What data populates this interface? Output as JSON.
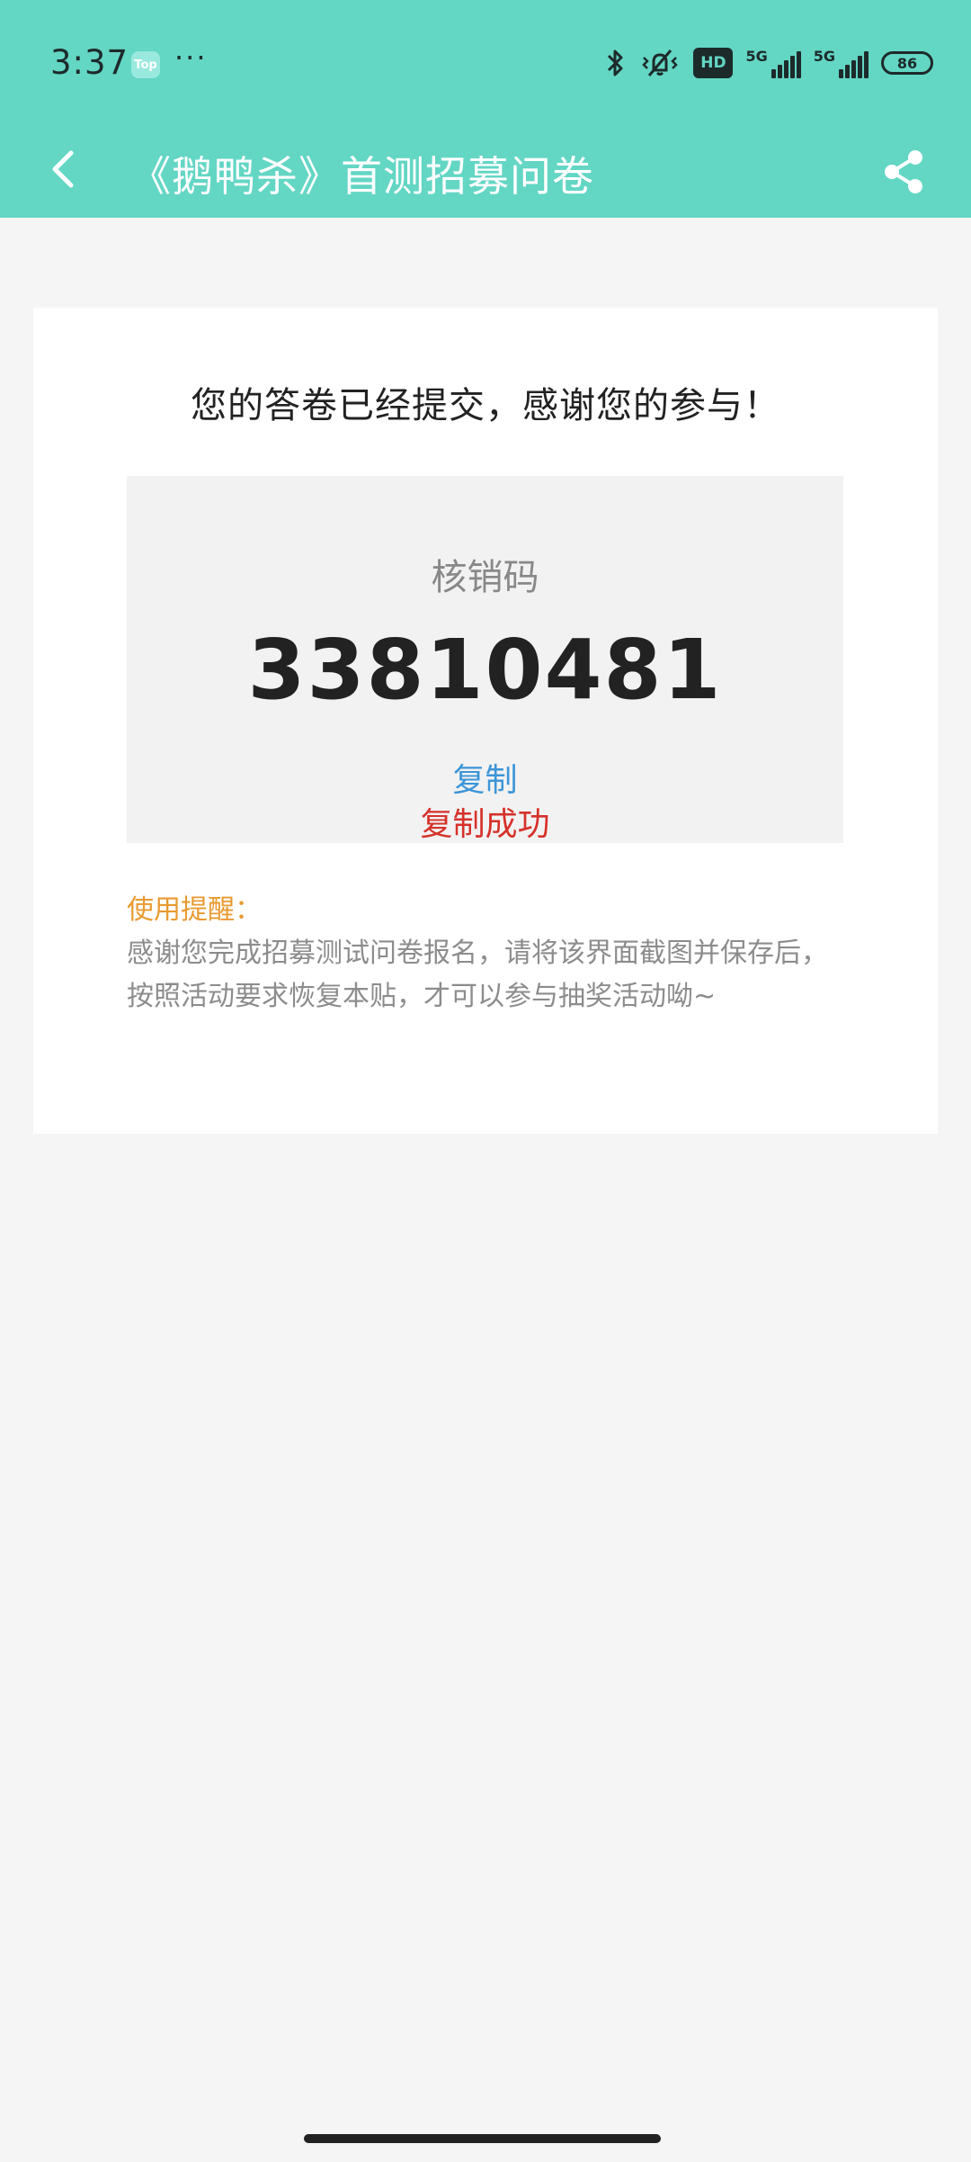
{
  "status_bar": {
    "time": "3:37",
    "top_badge": "Top",
    "more_indicator": "···",
    "hd_label": "HD",
    "network_tag_1": "5G",
    "network_tag_2": "5G",
    "battery": "86",
    "icons": [
      "bluetooth-icon",
      "vibrate-mute-icon",
      "hd-voice-icon",
      "signal-icon",
      "battery-icon"
    ]
  },
  "app_bar": {
    "title": "《鹅鸭杀》首测招募问卷",
    "back_icon": "chevron-left-icon",
    "share_icon": "share-icon"
  },
  "card": {
    "heading": "您的答卷已经提交，感谢您的参与！",
    "code_label": "核销码",
    "code_value": "33810481",
    "copy_label": "复制",
    "copy_status": "复制成功",
    "reminder_title": "使用提醒：",
    "reminder_text": "感谢您完成招募测试问卷报名，请将该界面截图并保存后，按照活动要求恢复本贴，才可以参与抽奖活动呦~"
  },
  "colors": {
    "header": "#63d6c4",
    "link": "#3c95d8",
    "success": "#d6312a",
    "reminder_title": "#e89a30"
  }
}
